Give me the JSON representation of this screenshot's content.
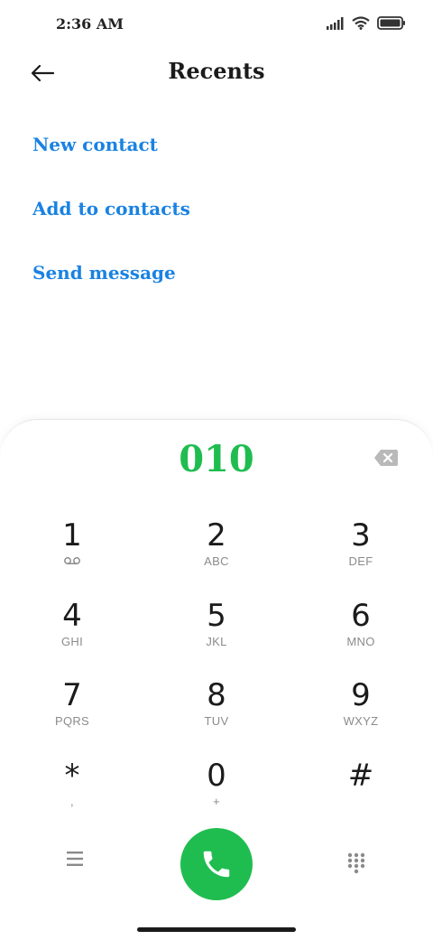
{
  "status_bar": {
    "time": "2:36 AM"
  },
  "header": {
    "title": "Recents",
    "back_icon": "arrow-left-icon"
  },
  "actions": [
    {
      "label": "New contact"
    },
    {
      "label": "Add to contacts"
    },
    {
      "label": "Send message"
    }
  ],
  "dialer": {
    "number": "010",
    "number_color": "#1fbd4f",
    "accent_color": "#1fbd4f",
    "link_color": "#1a82e2",
    "keys": [
      {
        "digit": "1",
        "letters": "",
        "icon": "voicemail-icon"
      },
      {
        "digit": "2",
        "letters": "ABC"
      },
      {
        "digit": "3",
        "letters": "DEF"
      },
      {
        "digit": "4",
        "letters": "GHI"
      },
      {
        "digit": "5",
        "letters": "JKL"
      },
      {
        "digit": "6",
        "letters": "MNO"
      },
      {
        "digit": "7",
        "letters": "PQRS"
      },
      {
        "digit": "8",
        "letters": "TUV"
      },
      {
        "digit": "9",
        "letters": "WXYZ"
      },
      {
        "digit": "*",
        "letters": ","
      },
      {
        "digit": "0",
        "letters": "+"
      },
      {
        "digit": "#",
        "letters": ""
      }
    ]
  }
}
